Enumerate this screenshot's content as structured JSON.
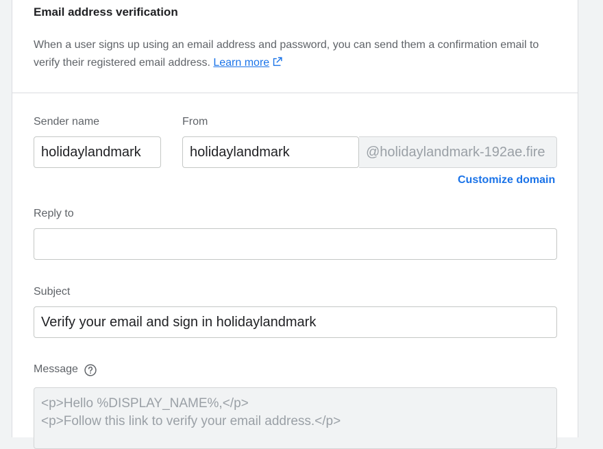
{
  "section": {
    "title": "Email address verification",
    "description": "When a user signs up using an email address and password, you can send them a confirmation email to verify their registered email address.",
    "learn_more": "Learn more"
  },
  "form": {
    "sender_name": {
      "label": "Sender name",
      "value": "holidaylandmark"
    },
    "from": {
      "label": "From",
      "value": "holidaylandmark",
      "domain": "@holidaylandmark-192ae.fire"
    },
    "customize_domain": "Customize domain",
    "reply_to": {
      "label": "Reply to",
      "value": ""
    },
    "subject": {
      "label": "Subject",
      "value": "Verify your email  and sign in holidaylandmark"
    },
    "message": {
      "label": "Message",
      "lines": [
        "<p>Hello %DISPLAY_NAME%,</p>",
        "<p>Follow this link to verify your email address.</p>"
      ]
    }
  },
  "colors": {
    "accent": "#1a73e8",
    "text": "#202124",
    "muted": "#5f6368"
  },
  "icons": {
    "external_link": "open-in-new-icon",
    "help": "help-circle-icon"
  }
}
